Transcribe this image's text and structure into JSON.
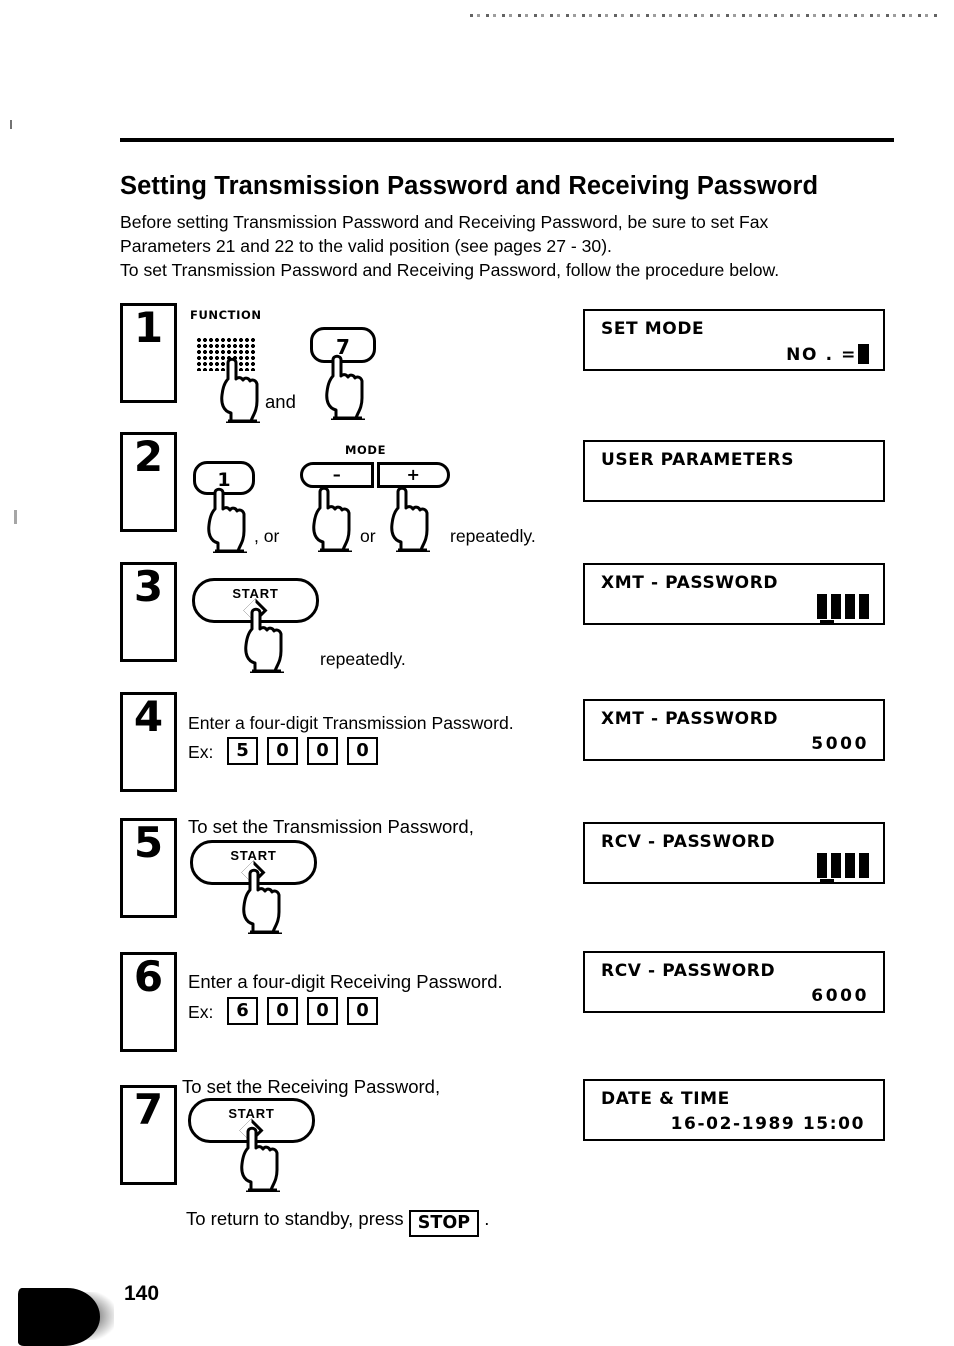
{
  "document": {
    "title": "Setting Transmission Password and Receiving Password",
    "intro_line1": "Before setting Transmission Password and Receiving Password, be sure to set Fax",
    "intro_line2": "Parameters 21 and 22 to the valid position (see pages 27 - 30).",
    "intro_line3": "To set Transmission Password and Receiving Password, follow the procedure below.",
    "page_number": "140",
    "footer_note_prefix": "To return to standby, press",
    "footer_note_key": "STOP",
    "footer_note_suffix": "."
  },
  "steps": [
    {
      "number": "1",
      "function_label": "FUNCTION",
      "key_digit": "7",
      "conjunction": "and"
    },
    {
      "number": "2",
      "key_digit": "1",
      "mode_label": "MODE",
      "mode_minus": "–",
      "mode_plus": "+",
      "sep1": ", or",
      "sep2": "or",
      "trailing": "repeatedly."
    },
    {
      "number": "3",
      "start_label": "START",
      "trailing": "repeatedly."
    },
    {
      "number": "4",
      "instruction": "Enter a four-digit Transmission Password.",
      "example_label": "Ex:",
      "example_digits": [
        "5",
        "0",
        "0",
        "0"
      ]
    },
    {
      "number": "5",
      "instruction": "To set the Transmission Password,",
      "start_label": "START"
    },
    {
      "number": "6",
      "instruction": "Enter a four-digit Receiving Password.",
      "example_label": "Ex:",
      "example_digits": [
        "6",
        "0",
        "0",
        "0"
      ]
    },
    {
      "number": "7",
      "instruction": "To set the Receiving Password,",
      "start_label": "START"
    }
  ],
  "displays": [
    {
      "line1": "SET  MODE",
      "line2": "NO . =",
      "cursor": true
    },
    {
      "line1": "USER  PARAMETERS",
      "line2": ""
    },
    {
      "line1": "XMT - PASSWORD",
      "line2": "",
      "masked": 4
    },
    {
      "line1": "XMT - PASSWORD",
      "line2": "5000"
    },
    {
      "line1": "RCV - PASSWORD",
      "line2": "",
      "masked": 4
    },
    {
      "line1": "RCV - PASSWORD",
      "line2": "6000"
    },
    {
      "line1": "DATE  &  TIME",
      "line2": "16-02-1989  15:00"
    }
  ]
}
